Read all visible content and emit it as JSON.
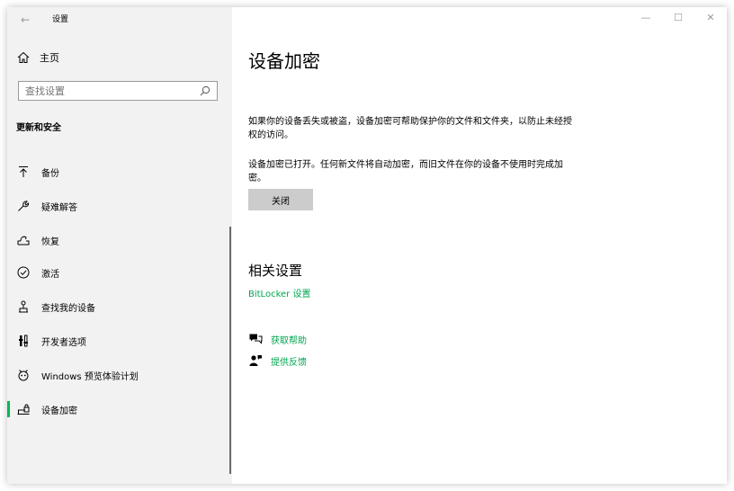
{
  "window": {
    "title": "设置",
    "back_icon": "back-arrow-icon",
    "controls": [
      "minimize-icon",
      "maximize-icon",
      "close-icon"
    ]
  },
  "sidebar": {
    "home_label": "主页",
    "search_placeholder": "查找设置",
    "section_header": "更新和安全",
    "items": [
      {
        "label": "备份",
        "icon": "backup-arrow-icon"
      },
      {
        "label": "疑难解答",
        "icon": "wrench-icon"
      },
      {
        "label": "恢复",
        "icon": "recovery-icon"
      },
      {
        "label": "激活",
        "icon": "check-circle-icon"
      },
      {
        "label": "查找我的设备",
        "icon": "find-device-icon"
      },
      {
        "label": "开发者选项",
        "icon": "developer-icon"
      },
      {
        "label": "Windows 预览体验计划",
        "icon": "insider-icon"
      },
      {
        "label": "设备加密",
        "icon": "device-encryption-icon",
        "selected": true
      }
    ],
    "accent_color": "#00b85c"
  },
  "main": {
    "title": "设备加密",
    "description_1": "如果你的设备丢失或被盗，设备加密可帮助保护你的文件和文件夹，以防止未经授权的访问。",
    "description_2": "设备加密已打开。任何新文件将自动加密，而旧文件在你的设备不使用时完成加密。",
    "close_button": "关闭",
    "related_title": "相关设置",
    "bitlocker_link": "BitLocker 设置",
    "get_help": "获取帮助",
    "feedback": "提供反馈",
    "link_color": "#00a650"
  }
}
